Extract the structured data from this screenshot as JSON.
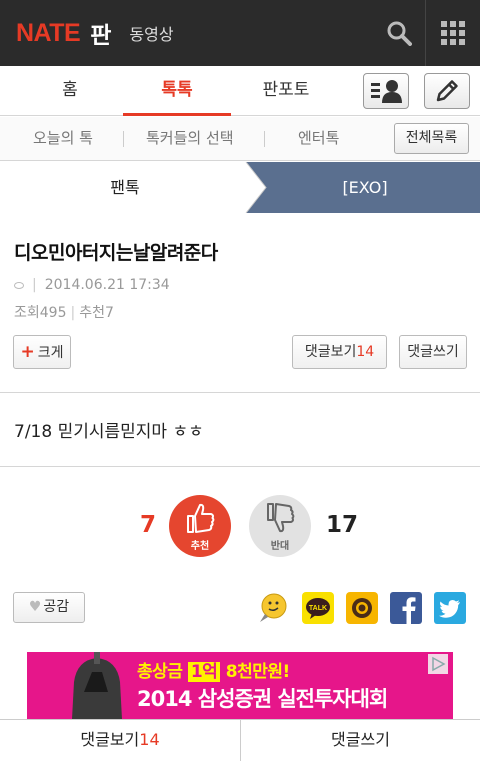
{
  "header": {
    "logo_nate": "NATE",
    "logo_pan": "판",
    "video_link": "동영상"
  },
  "tabs": [
    {
      "label": "홈"
    },
    {
      "label": "톡톡",
      "active": true
    },
    {
      "label": "판포토"
    }
  ],
  "subtabs": {
    "items": [
      "오늘의 톡",
      "톡커들의 선택",
      "엔터톡"
    ],
    "all_button": "전체목록"
  },
  "breadcrumb": {
    "level1": "팬톡",
    "level2": "[EXO]"
  },
  "article": {
    "title": "디오민아터지는날알려준다",
    "date": "2014.06.21 17:34",
    "views_label": "조회",
    "views": "495",
    "recommend_label": "추천",
    "recommend": "7",
    "body": "7/18 믿기시름믿지마 ㅎㅎ"
  },
  "buttons": {
    "enlarge": "크게",
    "view_comments": "댓글보기",
    "comment_count": "14",
    "write_comment": "댓글쓰기"
  },
  "votes": {
    "up_count": "7",
    "up_label": "추천",
    "down_count": "17",
    "down_label": "반대"
  },
  "share": {
    "empathy": "공감",
    "kakao_label": "TALK"
  },
  "ad": {
    "line1_prefix": "총상금",
    "line1_highlight": "1억",
    "line1_suffix": "8천만원!",
    "line2": "2014 삼성증권 실전투자대회"
  },
  "bottom_bar": {
    "view_comments": "댓글보기",
    "comment_count": "14",
    "write_comment": "댓글쓰기"
  },
  "colors": {
    "brand_red": "#e63a25",
    "header_bg": "#2b2b2b",
    "crumb_active_bg": "#5a6f8f",
    "ad_bg": "#e6168a"
  }
}
